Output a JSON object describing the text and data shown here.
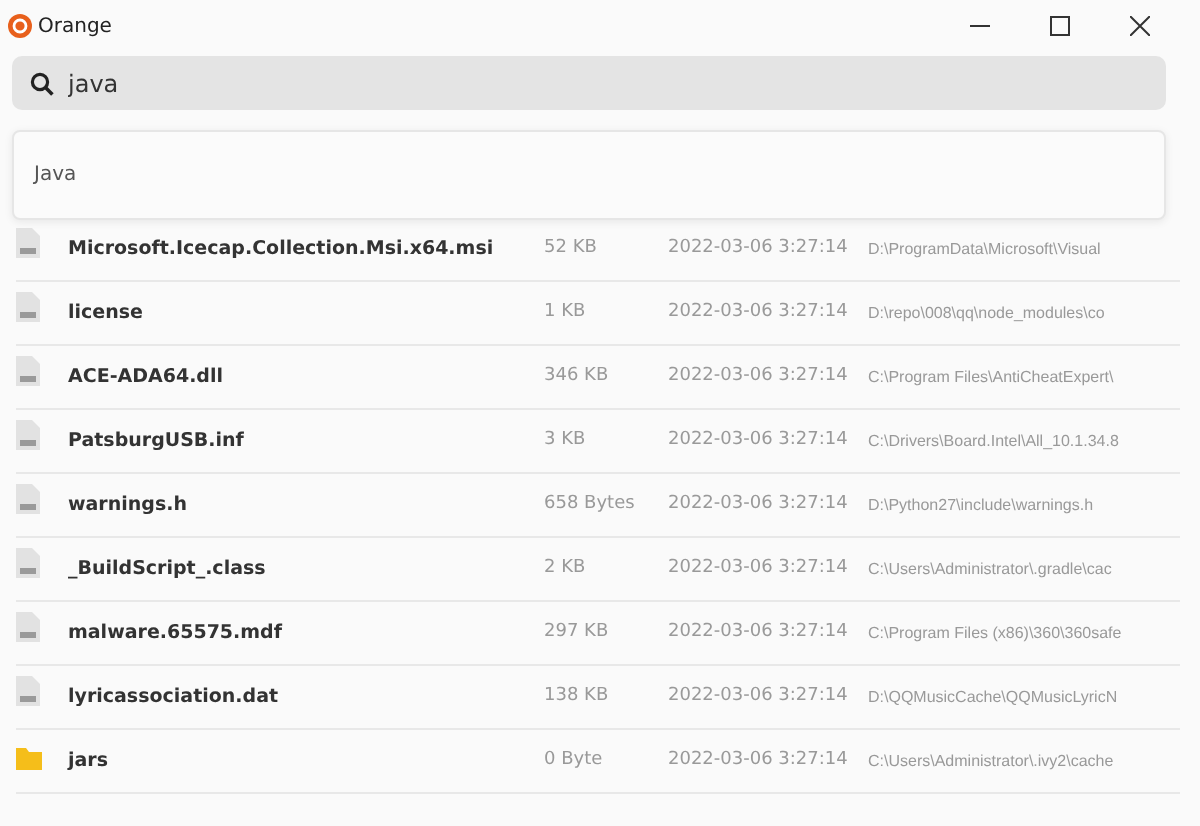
{
  "window": {
    "title": "Orange"
  },
  "search": {
    "value": "java"
  },
  "suggestions": [
    {
      "label": "Java"
    }
  ],
  "files": [
    {
      "kind": "file",
      "name": "Microsoft.Icecap.Collection.Msi.x64.msi",
      "size": "52 KB",
      "date": "2022-03-06 3:27:14",
      "path": "D:\\ProgramData\\Microsoft\\Visual"
    },
    {
      "kind": "file",
      "name": "license",
      "size": "1 KB",
      "date": "2022-03-06 3:27:14",
      "path": "D:\\repo\\008\\qq\\node_modules\\co"
    },
    {
      "kind": "file",
      "name": "ACE-ADA64.dll",
      "size": "346 KB",
      "date": "2022-03-06 3:27:14",
      "path": "C:\\Program Files\\AntiCheatExpert\\"
    },
    {
      "kind": "file",
      "name": "PatsburgUSB.inf",
      "size": "3 KB",
      "date": "2022-03-06 3:27:14",
      "path": "C:\\Drivers\\Board.Intel\\All_10.1.34.8"
    },
    {
      "kind": "file",
      "name": "warnings.h",
      "size": "658 Bytes",
      "date": "2022-03-06 3:27:14",
      "path": "D:\\Python27\\include\\warnings.h"
    },
    {
      "kind": "file",
      "name": "_BuildScript_.class",
      "size": "2 KB",
      "date": "2022-03-06 3:27:14",
      "path": "C:\\Users\\Administrator\\.gradle\\cac"
    },
    {
      "kind": "file",
      "name": "malware.65575.mdf",
      "size": "297 KB",
      "date": "2022-03-06 3:27:14",
      "path": "C:\\Program Files (x86)\\360\\360safe"
    },
    {
      "kind": "file",
      "name": "lyricassociation.dat",
      "size": "138 KB",
      "date": "2022-03-06 3:27:14",
      "path": "D:\\QQMusicCache\\QQMusicLyricN"
    },
    {
      "kind": "folder",
      "name": "jars",
      "size": "0 Byte",
      "date": "2022-03-06 3:27:14",
      "path": "C:\\Users\\Administrator\\.ivy2\\cache"
    }
  ]
}
